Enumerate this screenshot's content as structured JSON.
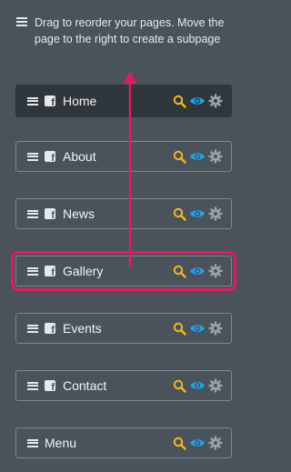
{
  "hint": {
    "text": "Drag to reorder your pages. Move the page to the right to create a subpage",
    "icon": "reorder-icon"
  },
  "colors": {
    "background": "#4a535c",
    "active_row": "#2f363c",
    "highlight": "#e8185e",
    "search_icon": "#f3b71e",
    "eye_icon": "#1ea3e6",
    "gear_icon": "#9aa2a9"
  },
  "pages": [
    {
      "label": "Home",
      "icon": "facebook-icon",
      "active": true
    },
    {
      "label": "About",
      "icon": "facebook-icon"
    },
    {
      "label": "News",
      "icon": "facebook-icon"
    },
    {
      "label": "Gallery",
      "icon": "facebook-icon",
      "highlighted": true
    },
    {
      "label": "Events",
      "icon": "facebook-icon"
    },
    {
      "label": "Contact",
      "icon": "facebook-icon"
    },
    {
      "label": "Menu",
      "icon": null
    }
  ]
}
